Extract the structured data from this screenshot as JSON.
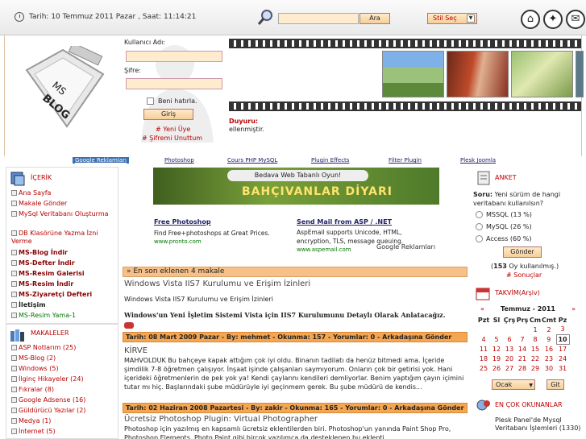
{
  "topbar": {
    "datetime": "Tarih: 10 Temmuz 2011 Pazar , Saat: 11:14:21",
    "search_button": "Ara",
    "style_select": "Stil Seç"
  },
  "logo": {
    "text": "MS BLOG"
  },
  "login": {
    "username_label": "Kullanıcı Adı:",
    "password_label": "Şifre:",
    "remember_label": "Beni hatırla.",
    "login_button": "Giriş",
    "register_link": "# Yeni Üye",
    "forgot_link": "# Şifremi Unuttum"
  },
  "announcement": {
    "label": "Duyuru:",
    "text": "ellenmiştir."
  },
  "ad_links": {
    "google_ads": "Google Reklamları",
    "links": [
      "Photoshop",
      "Cours PHP MySQL",
      "Plugin Effects",
      "Filter Plugin",
      "Plesk Joomla"
    ]
  },
  "left_sidebar": {
    "content_title": "İÇERİK",
    "content_items": [
      {
        "label": "Ana Sayfa",
        "bold": false
      },
      {
        "label": "Makale Gönder",
        "bold": false
      },
      {
        "label": "MySql Veritabanı Oluşturma",
        "bold": false
      },
      {
        "label": "DB Klasörüne Yazma İzni Verme",
        "bold": false
      },
      {
        "label": "MS-Blog İndir",
        "bold": true
      },
      {
        "label": "MS-Defter İndir",
        "bold": true
      },
      {
        "label": "MS-Resim Galerisi",
        "bold": true
      },
      {
        "label": "MS-Resim İndir",
        "bold": true
      },
      {
        "label": "MS-Ziyaretçi Defteri",
        "bold": true
      },
      {
        "label": "İletişim",
        "bold": true
      },
      {
        "label": "MS-Resim Yama-1",
        "bold": false
      }
    ],
    "articles_title": "MAKALELER",
    "article_categories": [
      "ASP Notlarım (25)",
      "MS-Blog (2)",
      "Windows (5)",
      "İlginç Hikayeler (24)",
      "Fıkralar (8)",
      "Google Adsense (16)",
      "Güldürücü Yazılar (2)",
      "Medya (1)",
      "İnternet (5)"
    ]
  },
  "center": {
    "banner_tag": "Bedava Web Tabanlı Oyun!",
    "banner_title": "BAHÇIVANLAR DİYARI",
    "ad1_title": "Free Photoshop",
    "ad1_text": "Find Free+photoshops at Great Prices.",
    "ad1_url": "www.pronto.com",
    "ad2_title": "Send Mail from ASP / .NET",
    "ad2_text": "AspEmail supports Unicode, HTML, encryption, TLS, message queuing.",
    "ad2_url": "www.aspemail.com",
    "ad_brand": "Google Reklamları",
    "latest_header": "» En son eklenen 4 makale",
    "articles": [
      {
        "title": "Windows Vista IIS7 Kurulumu ve Erişim İzinleri",
        "body1": "Windows Vista IIS7 Kurulumu ve Erişim İzinleri",
        "body2": "Windows'un Yeni İşletim Sistemi Vista için IIS7 Kurulumunu Detaylı Olarak Anlatacağız.",
        "meta": "Tarih: 08 Mart 2009 Pazar - By: mehmet - Okunma: 157 - Yorumlar: 0 - Arkadaşına Gönder"
      },
      {
        "title": "KİRVE",
        "body1": "MAHVOLDUK Bu bahçeye kapak attığım çok iyi oldu. Binanın tadilatı da henüz bitmedi ama. İçeride şimdilik 7-8 öğretmen çalışıyor. İnşaat işinde çalışanları saymıyorum. Onların çok bir getirisi yok. Hani içerideki öğretmenlerin de pek yok ya! Kendi çaylarını kendileri demliyorlar. Benim yaptığım çayın içimini tutar mı hiç. Başlarındaki şube müdürüyle iyi geçinmem gerek. Bu şube müdürü de kendis...",
        "meta": "Tarih: 02 Haziran 2008 Pazartesi - By: zakir - Okunma: 165 - Yorumlar: 0 - Arkadaşına Gönder"
      },
      {
        "title": "Ücretsiz Photoshop Plugin: Virtual Photographer",
        "body1": "Photoshop için yazılmış en kapsamlı ücretsiz eklentilerden biri. Photoshop'un yanında Paint Shop Pro, Photoshop Elements, Photo Paint gibi birçok yazılımca da desteklenen bu eklenti..."
      }
    ]
  },
  "right_sidebar": {
    "poll_title": "ANKET",
    "poll_question_label": "Soru:",
    "poll_question": "Yeni sürüm de hangi veritabanı kullanılsın?",
    "options": [
      "MSSQL (13 %)",
      "MySQL (26 %)",
      "Access (60 %)"
    ],
    "vote_button": "Gönder",
    "votes_count": "153",
    "votes_suffix": "Oy kullanılmış.)",
    "results_link": "# Sonuçlar",
    "calendar_title": "TAKVİM(Arşiv)",
    "calendar_month": "Temmuz - 2011",
    "weekdays": [
      "Pzt",
      "Sl",
      "Çrş",
      "Prş",
      "Cm",
      "Cmt",
      "Pz"
    ],
    "weeks": [
      [
        "",
        "",
        "",
        "",
        "1",
        "2",
        "3"
      ],
      [
        "4",
        "5",
        "6",
        "7",
        "8",
        "9",
        "10"
      ],
      [
        "11",
        "12",
        "13",
        "14",
        "15",
        "16",
        "17"
      ],
      [
        "18",
        "19",
        "20",
        "21",
        "22",
        "23",
        "24"
      ],
      [
        "25",
        "26",
        "27",
        "28",
        "29",
        "30",
        "31"
      ]
    ],
    "today": "10",
    "month_select": "Ocak",
    "go_button": "Git",
    "popular_title": "EN ÇOK OKUNANLAR",
    "popular_items": [
      "Plesk Panel'de Mysql Veritabanı İşlemleri (1330)"
    ]
  }
}
